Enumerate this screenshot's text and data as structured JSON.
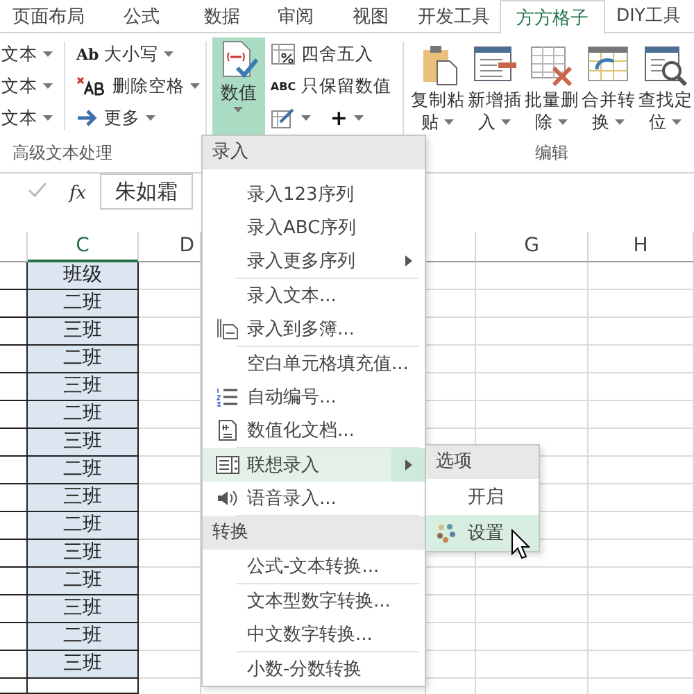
{
  "ribbon_tabs": [
    {
      "label": "页面布局",
      "selected": false
    },
    {
      "label": "公式",
      "selected": false
    },
    {
      "label": "数据",
      "selected": false
    },
    {
      "label": "审阅",
      "selected": false
    },
    {
      "label": "视图",
      "selected": false
    },
    {
      "label": "开发工具",
      "selected": false
    },
    {
      "label": "方方格子",
      "selected": true
    },
    {
      "label": "DIY工具",
      "selected": false
    }
  ],
  "ribbon": {
    "text_group": {
      "column_1": [
        "文本",
        "文本",
        "文本"
      ],
      "column_2": [
        "大小写",
        "删除空格",
        "更多"
      ],
      "ab_glyph": "Ab",
      "label": "高级文本处理"
    },
    "number_button": {
      "label": "数值",
      "selected": true
    },
    "number_tools": [
      "四舍五入",
      "只保留数值"
    ],
    "abc_glyph": "ABC",
    "plus": "+",
    "edit_group": {
      "buttons": [
        {
          "lines": [
            "复制粘",
            "贴"
          ]
        },
        {
          "lines": [
            "新增插",
            "入"
          ]
        },
        {
          "lines": [
            "批量删",
            "除"
          ]
        },
        {
          "lines": [
            "合并转",
            "换"
          ]
        },
        {
          "lines": [
            "查找定",
            "位"
          ]
        }
      ],
      "label": "编辑"
    }
  },
  "formula_bar": {
    "function": "fx",
    "value": "朱如霜"
  },
  "sheet": {
    "columns": [
      {
        "label": "C",
        "selected": true
      },
      {
        "label": "D",
        "selected": false
      },
      {
        "label": "G",
        "selected": false
      },
      {
        "label": "H",
        "selected": false
      }
    ],
    "rows": [
      "班级",
      "二班",
      "三班",
      "二班",
      "三班",
      "二班",
      "三班",
      "二班",
      "三班",
      "二班",
      "三班",
      "二班",
      "三班",
      "二班",
      "三班"
    ]
  },
  "menu": {
    "sections": [
      {
        "title": "录入",
        "groups": [
          [
            {
              "label": "录入123序列",
              "submenu": false,
              "selected": false
            },
            {
              "label": "录入ABC序列",
              "submenu": false,
              "selected": false
            },
            {
              "label": "录入更多序列",
              "submenu": true,
              "selected": false
            }
          ],
          [
            {
              "label": "录入文本...",
              "submenu": false,
              "selected": false
            },
            {
              "label": "录入到多簿...",
              "submenu": false,
              "selected": false
            }
          ],
          [
            {
              "label": "空白单元格填充值...",
              "submenu": false,
              "selected": false
            },
            {
              "label": "自动编号...",
              "submenu": false,
              "selected": false
            },
            {
              "label": "数值化文档...",
              "submenu": false,
              "selected": false
            }
          ],
          [
            {
              "label": "联想录入",
              "submenu": true,
              "selected": true
            },
            {
              "label": "语音录入...",
              "submenu": false,
              "selected": false
            }
          ]
        ]
      },
      {
        "title": "转换",
        "groups": [
          [
            {
              "label": "公式-文本转换...",
              "submenu": false,
              "selected": false
            }
          ],
          [
            {
              "label": "文本型数字转换...",
              "submenu": false,
              "selected": false
            },
            {
              "label": "中文数字转换...",
              "submenu": false,
              "selected": false
            }
          ],
          [
            {
              "label": "小数-分数转换",
              "submenu": false,
              "selected": false
            }
          ]
        ]
      }
    ]
  },
  "submenu": {
    "title": "选项",
    "items": [
      {
        "label": "开启",
        "selected": false
      },
      {
        "label": "设置",
        "selected": true
      }
    ]
  }
}
